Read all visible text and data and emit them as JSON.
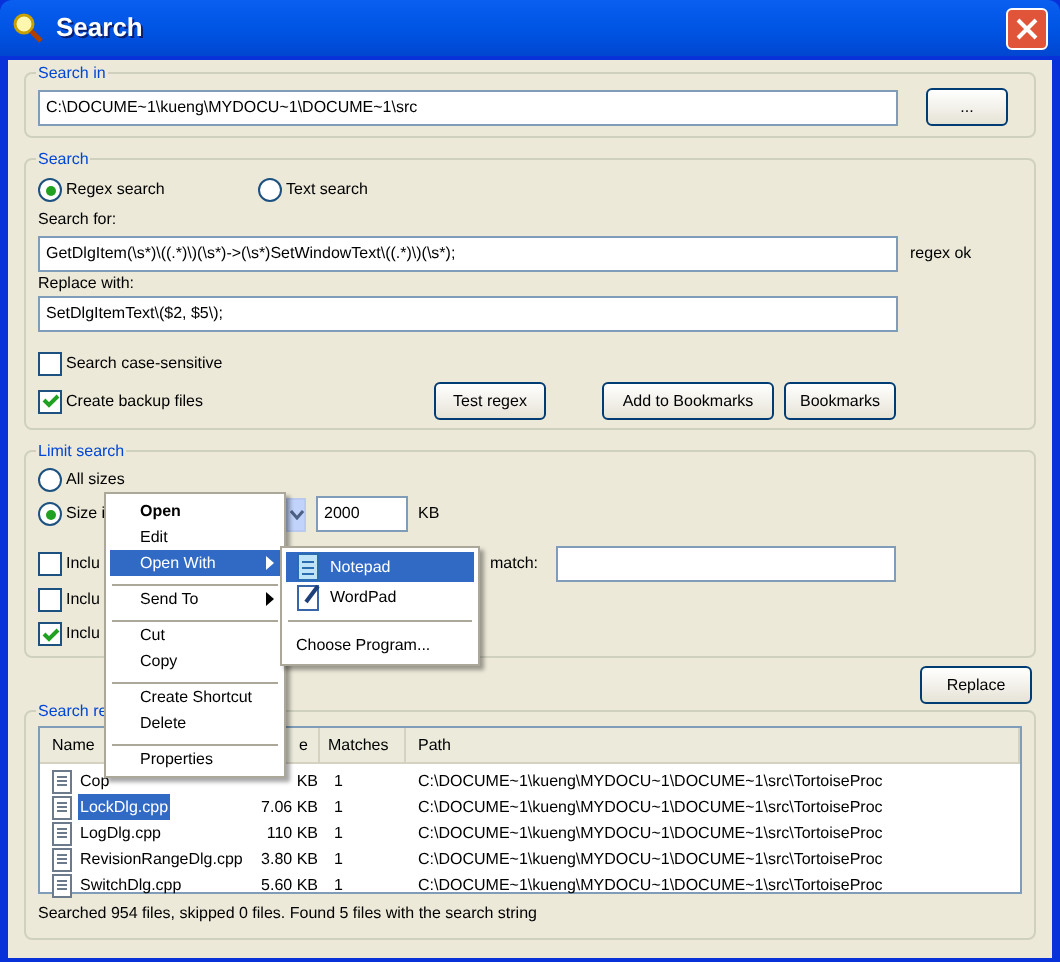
{
  "window": {
    "title": "Search"
  },
  "search_in": {
    "label": "Search in",
    "path": "C:\\DOCUME~1\\kueng\\MYDOCU~1\\DOCUME~1\\src",
    "browse_button": "..."
  },
  "search": {
    "label": "Search",
    "modes": [
      {
        "label": "Regex search",
        "selected": true
      },
      {
        "label": "Text search",
        "selected": false
      }
    ],
    "search_for_label": "Search for:",
    "search_for": "GetDlgItem(\\s*)\\((.*)\\)(\\s*)->(\\s*)SetWindowText\\((.*)\\)(\\s*);",
    "regex_status": "regex ok",
    "replace_label": "Replace with:",
    "replace_with": "SetDlgItemText\\($2, $5\\);",
    "options": [
      {
        "label": "Search case-sensitive",
        "checked": false
      },
      {
        "label": "Create backup files",
        "checked": true
      }
    ],
    "buttons": [
      "Test regex",
      "Add to Bookmarks",
      "Bookmarks"
    ]
  },
  "limit_search": {
    "label": "Limit search",
    "size_modes": [
      {
        "label": "All sizes",
        "selected": false
      },
      {
        "label": "Size i",
        "selected": true
      }
    ],
    "size_value": "2000",
    "size_unit": "KB",
    "includes": [
      {
        "label": "Inclu",
        "checked": false
      },
      {
        "label": "Inclu",
        "checked": false
      },
      {
        "label": "Inclu",
        "checked": true
      }
    ],
    "match_label": "match:"
  },
  "replace_button": "Replace",
  "results": {
    "label": "Search re",
    "columns": [
      "Name",
      "e",
      "Matches",
      "Path"
    ],
    "rows": [
      {
        "name": "Cop",
        "size": "KB",
        "matches": "1",
        "path": "C:\\DOCUME~1\\kueng\\MYDOCU~1\\DOCUME~1\\src\\TortoiseProc",
        "selected": false
      },
      {
        "name": "LockDlg.cpp",
        "size": "7.06 KB",
        "matches": "1",
        "path": "C:\\DOCUME~1\\kueng\\MYDOCU~1\\DOCUME~1\\src\\TortoiseProc",
        "selected": true
      },
      {
        "name": "LogDlg.cpp",
        "size": "110 KB",
        "matches": "1",
        "path": "C:\\DOCUME~1\\kueng\\MYDOCU~1\\DOCUME~1\\src\\TortoiseProc",
        "selected": false
      },
      {
        "name": "RevisionRangeDlg.cpp",
        "size": "3.80 KB",
        "matches": "1",
        "path": "C:\\DOCUME~1\\kueng\\MYDOCU~1\\DOCUME~1\\src\\TortoiseProc",
        "selected": false
      },
      {
        "name": "SwitchDlg.cpp",
        "size": "5.60 KB",
        "matches": "1",
        "path": "C:\\DOCUME~1\\kueng\\MYDOCU~1\\DOCUME~1\\src\\TortoiseProc",
        "selected": false
      }
    ],
    "status": "Searched 954 files, skipped 0 files. Found 5 files with the search string"
  },
  "context_menu": {
    "items": [
      {
        "kind": "default",
        "label": "Open",
        "selected": false
      },
      {
        "kind": "item",
        "label": "Edit",
        "selected": false
      },
      {
        "kind": "submenu",
        "label": "Open With",
        "selected": true
      },
      {
        "kind": "separator"
      },
      {
        "kind": "submenu",
        "label": "Send To",
        "selected": false
      },
      {
        "kind": "separator"
      },
      {
        "kind": "item",
        "label": "Cut",
        "selected": false
      },
      {
        "kind": "item",
        "label": "Copy",
        "selected": false
      },
      {
        "kind": "separator"
      },
      {
        "kind": "item",
        "label": "Create Shortcut",
        "selected": false
      },
      {
        "kind": "item",
        "label": "Delete",
        "selected": false
      },
      {
        "kind": "separator"
      },
      {
        "kind": "item",
        "label": "Properties",
        "selected": false
      }
    ]
  },
  "submenu": {
    "items": [
      {
        "kind": "notepad",
        "label": "Notepad",
        "selected": true
      },
      {
        "kind": "wordpad",
        "label": "WordPad",
        "selected": false
      },
      {
        "kind": "separator"
      },
      {
        "kind": "item",
        "label": "Choose Program...",
        "selected": false
      }
    ]
  }
}
